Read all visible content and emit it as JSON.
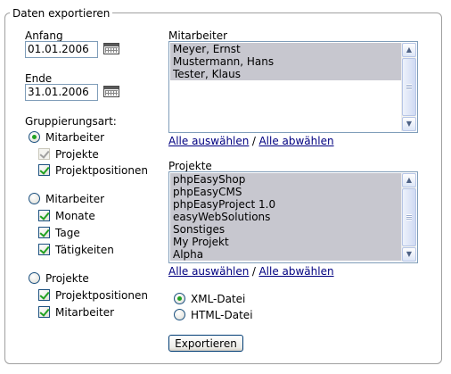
{
  "legend": "Daten exportieren",
  "start": {
    "label": "Anfang",
    "value": "01.01.2006"
  },
  "end": {
    "label": "Ende",
    "value": "31.01.2006"
  },
  "grouping": {
    "label": "Gruppierungsart:",
    "groups": [
      {
        "label": "Mitarbeiter",
        "selected": true,
        "options": [
          {
            "label": "Projekte",
            "checked": true,
            "disabled": true
          },
          {
            "label": "Projektpositionen",
            "checked": true,
            "disabled": false
          }
        ]
      },
      {
        "label": "Mitarbeiter",
        "selected": false,
        "options": [
          {
            "label": "Monate",
            "checked": true,
            "disabled": false
          },
          {
            "label": "Tage",
            "checked": true,
            "disabled": false
          },
          {
            "label": "Tätigkeiten",
            "checked": true,
            "disabled": false
          }
        ]
      },
      {
        "label": "Projekte",
        "selected": false,
        "options": [
          {
            "label": "Projektpositionen",
            "checked": true,
            "disabled": false
          },
          {
            "label": "Mitarbeiter",
            "checked": true,
            "disabled": false
          }
        ]
      }
    ]
  },
  "employees": {
    "label": "Mitarbeiter",
    "items": [
      "Meyer, Ernst",
      "Mustermann, Hans",
      "Tester, Klaus"
    ],
    "select_all": "Alle auswählen",
    "separator": "/",
    "deselect_all": "Alle abwählen"
  },
  "projects": {
    "label": "Projekte",
    "items": [
      "phpEasyShop",
      "phpEasyCMS",
      "phpEasyProject 1.0",
      "easyWebSolutions",
      "Sonstiges",
      "My Projekt",
      "Alpha"
    ],
    "select_all": "Alle auswählen",
    "separator": "/",
    "deselect_all": "Alle abwählen"
  },
  "format": {
    "options": [
      {
        "label": "XML-Datei",
        "selected": true
      },
      {
        "label": "HTML-Datei",
        "selected": false
      }
    ]
  },
  "export_button": "Exportieren",
  "colors": {
    "selection": "#c7c7cf",
    "link": "#000080",
    "check": "#21a121",
    "border": "#7f9db9"
  },
  "icons": {
    "calendar": "calendar-icon",
    "scroll_up": "arrow-up-icon",
    "scroll_down": "arrow-down-icon"
  }
}
